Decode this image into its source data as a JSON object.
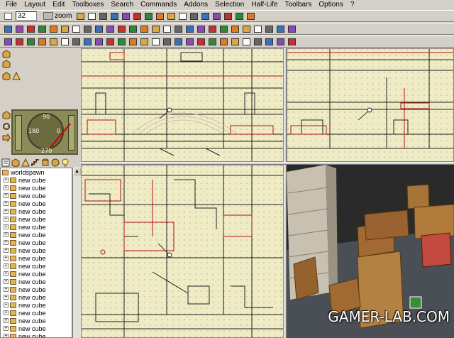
{
  "menu": [
    "File",
    "Layout",
    "Edit",
    "Toolboxes",
    "Search",
    "Commands",
    "Addons",
    "Selection",
    "Half-Life",
    "Toolbars",
    "Options",
    "?"
  ],
  "toolbar1": {
    "grid_size": "32",
    "zoom_label": "zoom"
  },
  "compass": {
    "top": "90",
    "left": "180",
    "right": "0",
    "bottom": "270"
  },
  "tree": {
    "root": "worldspawn",
    "items": [
      "new cube",
      "new cube",
      "new cube",
      "new cube",
      "new cube",
      "new cube",
      "new cube",
      "new cube",
      "new cube",
      "new cube",
      "new cube",
      "new cube",
      "new cube",
      "new cube",
      "new cube",
      "new cube",
      "new cube",
      "new cube",
      "new cube",
      "new cube",
      "new cube"
    ]
  },
  "watermark": "GAMER-LAB.COM",
  "colors": {
    "grid_bg": "#efecc5",
    "wire_red": "#b01010",
    "wire_black": "#202020",
    "ui_face": "#d4d0c8"
  },
  "icons": [
    "new-file-icon",
    "open-icon",
    "save-icon",
    "cube-icon",
    "undo-icon",
    "redo-icon",
    "hand-icon",
    "select-icon",
    "sphere-icon",
    "cylinder-icon",
    "light-bulb-icon"
  ]
}
